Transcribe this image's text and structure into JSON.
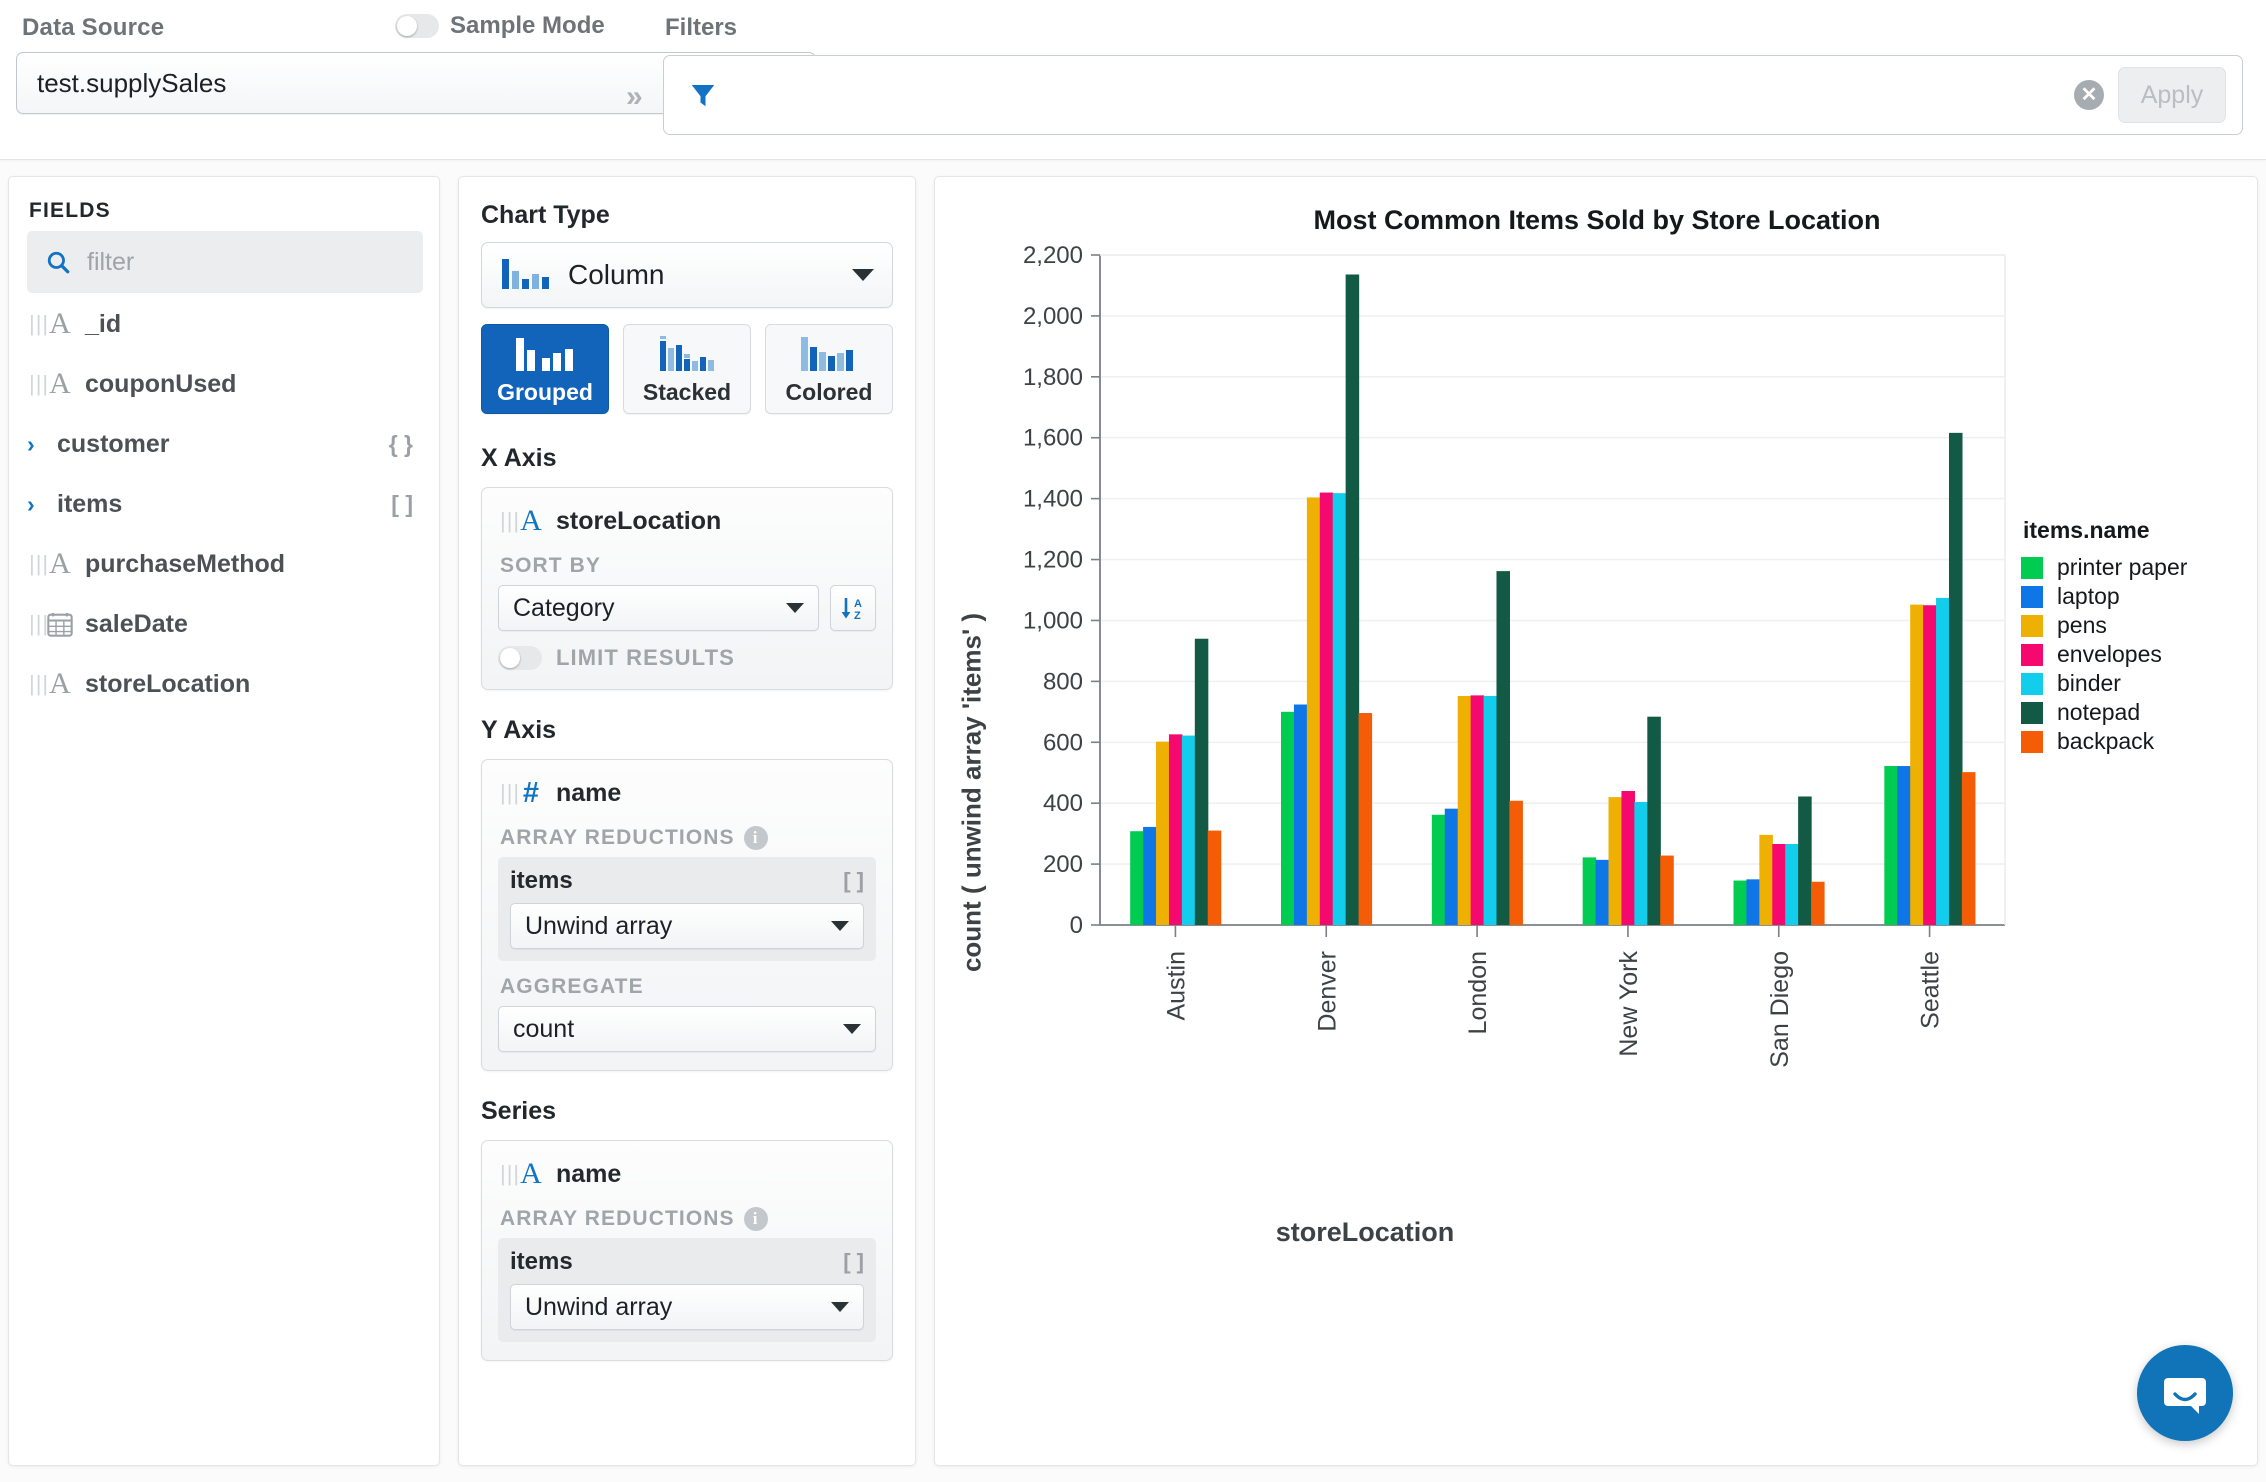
{
  "topbar": {
    "data_source_label": "Data Source",
    "sample_mode_label": "Sample Mode",
    "data_source_value": "test.supplySales",
    "chevron": "»",
    "filters_label": "Filters",
    "filter_value": "",
    "filter_placeholder": "",
    "apply_label": "Apply",
    "clear_icon": "✕"
  },
  "fields": {
    "title": "FIELDS",
    "filter_placeholder": "filter",
    "filter_value": "",
    "items": [
      {
        "label": "_id",
        "type": "string",
        "icon": "A",
        "badge": ""
      },
      {
        "label": "couponUsed",
        "type": "string",
        "icon": "A",
        "badge": ""
      },
      {
        "label": "customer",
        "type": "object",
        "icon": ">",
        "badge": "{ }"
      },
      {
        "label": "items",
        "type": "array",
        "icon": ">",
        "badge": "[ ]"
      },
      {
        "label": "purchaseMethod",
        "type": "string",
        "icon": "A",
        "badge": ""
      },
      {
        "label": "saleDate",
        "type": "date",
        "icon": "cal",
        "badge": ""
      },
      {
        "label": "storeLocation",
        "type": "string",
        "icon": "A",
        "badge": ""
      }
    ]
  },
  "encoding": {
    "chart_type_title": "Chart Type",
    "chart_type_value": "Column",
    "variants": [
      {
        "label": "Grouped",
        "active": true
      },
      {
        "label": "Stacked",
        "active": false
      },
      {
        "label": "Colored",
        "active": false
      }
    ],
    "x_axis": {
      "title": "X Axis",
      "field": "storeLocation",
      "field_type": "A",
      "sort_by_label": "SORT BY",
      "sort_by_value": "Category",
      "sort_direction_icon": "sort-az-icon",
      "limit_results_label": "LIMIT RESULTS",
      "limit_results_on": false
    },
    "y_axis": {
      "title": "Y Axis",
      "field": "name",
      "field_type": "#",
      "array_reductions_label": "ARRAY REDUCTIONS",
      "reduction_field": "items",
      "reduction_badge": "[ ]",
      "reduction_value": "Unwind array",
      "aggregate_label": "AGGREGATE",
      "aggregate_value": "count"
    },
    "series": {
      "title": "Series",
      "field": "name",
      "field_type": "A",
      "array_reductions_label": "ARRAY REDUCTIONS",
      "reduction_field": "items",
      "reduction_badge": "[ ]",
      "reduction_value": "Unwind array"
    }
  },
  "chart_data": {
    "type": "bar",
    "title": "Most Common Items Sold by Store Location",
    "xlabel": "storeLocation",
    "ylabel": "count ( unwind array 'items' )",
    "legend_title": "items.name",
    "legend_position": "right",
    "grid": true,
    "ylim": [
      0,
      2200
    ],
    "yticks": [
      0,
      200,
      400,
      600,
      800,
      1000,
      1200,
      1400,
      1600,
      1800,
      2000,
      2200
    ],
    "ytick_labels": [
      "0",
      "200",
      "400",
      "600",
      "800",
      "1,000",
      "1,200",
      "1,400",
      "1,600",
      "1,800",
      "2,000",
      "2,200"
    ],
    "categories": [
      "Austin",
      "Denver",
      "London",
      "New York",
      "San Diego",
      "Seattle"
    ],
    "series": [
      {
        "name": "printer paper",
        "color": "#00cc52",
        "values": [
          308,
          700,
          362,
          222,
          146,
          522
        ]
      },
      {
        "name": "laptop",
        "color": "#0f76e8",
        "values": [
          322,
          724,
          382,
          214,
          150,
          522
        ]
      },
      {
        "name": "pens",
        "color": "#efb004",
        "values": [
          602,
          1404,
          752,
          420,
          296,
          1052
        ]
      },
      {
        "name": "envelopes",
        "color": "#f5096f",
        "values": [
          626,
          1420,
          754,
          440,
          266,
          1050
        ]
      },
      {
        "name": "binder",
        "color": "#13cdec",
        "values": [
          622,
          1418,
          752,
          404,
          266,
          1074
        ]
      },
      {
        "name": "notepad",
        "color": "#125a43",
        "values": [
          940,
          2136,
          1162,
          684,
          422,
          1616
        ]
      },
      {
        "name": "backpack",
        "color": "#f55c06",
        "values": [
          310,
          696,
          408,
          228,
          142,
          502
        ]
      }
    ]
  },
  "chat": {
    "icon": "chat-bubble-icon"
  }
}
